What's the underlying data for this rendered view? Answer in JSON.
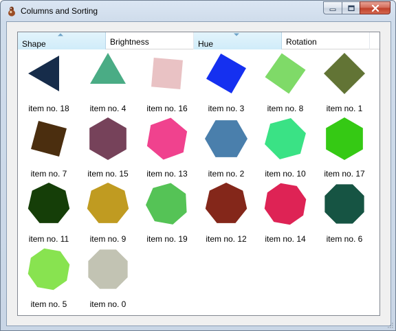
{
  "window": {
    "title": "Columns and Sorting",
    "buttons": {
      "minimize": "minimize-icon",
      "maximize": "maximize-icon",
      "close": "close-icon"
    }
  },
  "listview": {
    "columns": [
      {
        "label": "Shape",
        "sorted": true,
        "sort_direction": "ascending"
      },
      {
        "label": "Brightness",
        "sorted": false
      },
      {
        "label": "Hue",
        "sorted": true,
        "sort_direction": "descending"
      },
      {
        "label": "Rotation",
        "sorted": false
      }
    ],
    "items": [
      {
        "label": "item no. 18",
        "shape": "triangle",
        "sides": 3,
        "color": "#162c4a",
        "rotation": 30
      },
      {
        "label": "item no. 4",
        "shape": "triangle",
        "sides": 3,
        "color": "#4aac85",
        "rotation": 0
      },
      {
        "label": "item no. 16",
        "shape": "square",
        "sides": 4,
        "color": "#e9c2c4",
        "rotation": 5
      },
      {
        "label": "item no. 3",
        "shape": "square",
        "sides": 4,
        "color": "#1530f0",
        "rotation": 30
      },
      {
        "label": "item no. 8",
        "shape": "square",
        "sides": 4,
        "color": "#7fda68",
        "rotation": 35
      },
      {
        "label": "item no. 1",
        "shape": "square",
        "sides": 4,
        "color": "#627435",
        "rotation": 45
      },
      {
        "label": "item no. 7",
        "shape": "square",
        "sides": 4,
        "color": "#4b2e0f",
        "rotation": 15
      },
      {
        "label": "item no. 15",
        "shape": "hexagon",
        "sides": 6,
        "color": "#76425a",
        "rotation": 0
      },
      {
        "label": "item no. 13",
        "shape": "hexagon",
        "sides": 6,
        "color": "#f0428e",
        "rotation": 10
      },
      {
        "label": "item no. 2",
        "shape": "hexagon",
        "sides": 6,
        "color": "#4a7fac",
        "rotation": 30
      },
      {
        "label": "item no. 10",
        "shape": "hexagon",
        "sides": 6,
        "color": "#3ae285",
        "rotation": 15
      },
      {
        "label": "item no. 17",
        "shape": "hexagon",
        "sides": 6,
        "color": "#35c914",
        "rotation": 0
      },
      {
        "label": "item no. 11",
        "shape": "heptagon",
        "sides": 7,
        "color": "#153e08",
        "rotation": 0
      },
      {
        "label": "item no. 9",
        "shape": "heptagon",
        "sides": 7,
        "color": "#c09b21",
        "rotation": 0
      },
      {
        "label": "item no. 19",
        "shape": "heptagon",
        "sides": 7,
        "color": "#55c356",
        "rotation": 10
      },
      {
        "label": "item no. 12",
        "shape": "heptagon",
        "sides": 7,
        "color": "#84271a",
        "rotation": 0
      },
      {
        "label": "item no. 14",
        "shape": "octagon",
        "sides": 8,
        "color": "#de2355",
        "rotation": 10
      },
      {
        "label": "item no. 6",
        "shape": "octagon",
        "sides": 8,
        "color": "#165443",
        "rotation": 0
      },
      {
        "label": "item no. 5",
        "shape": "octagon",
        "sides": 8,
        "color": "#88e350",
        "rotation": 10
      },
      {
        "label": "item no. 0",
        "shape": "octagon",
        "sides": 8,
        "color": "#c2c3b3",
        "rotation": 0
      }
    ]
  },
  "colors": {
    "sorted_header": "#d0ecf9",
    "sort_arrow": "#6fa3c8",
    "close_button": "#c0412b"
  }
}
